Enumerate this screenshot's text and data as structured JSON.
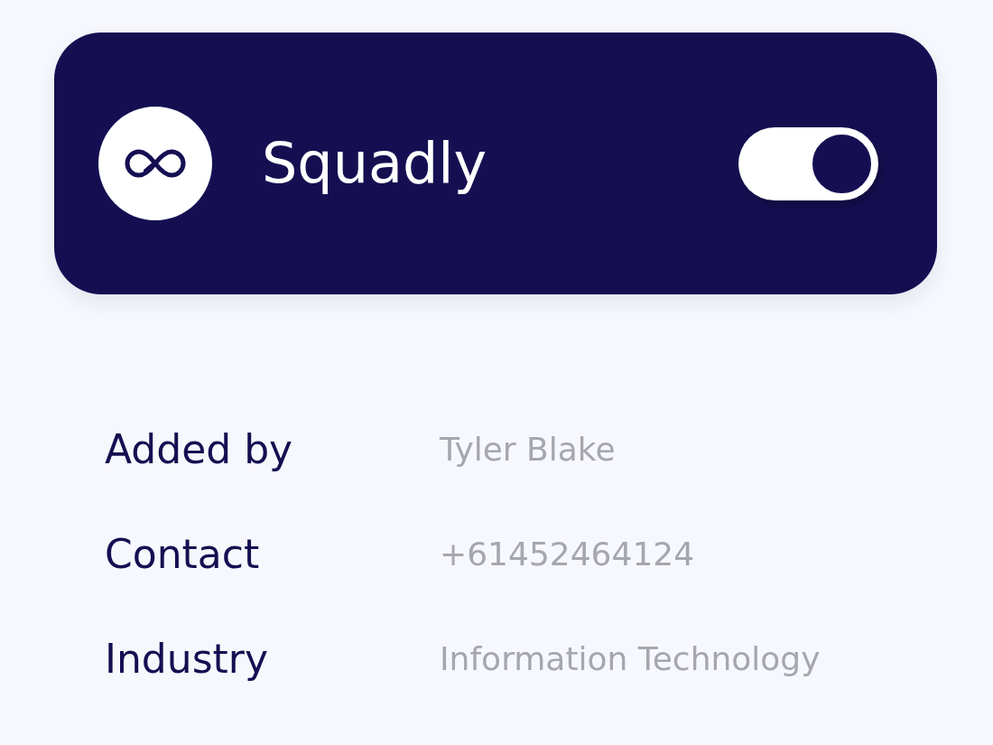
{
  "app": {
    "name": "Squadly",
    "enabled": true
  },
  "details": [
    {
      "label": "Added by",
      "value": "Tyler Blake"
    },
    {
      "label": "Contact",
      "value": "+61452464124"
    },
    {
      "label": "Industry",
      "value": "Information Technology"
    }
  ]
}
